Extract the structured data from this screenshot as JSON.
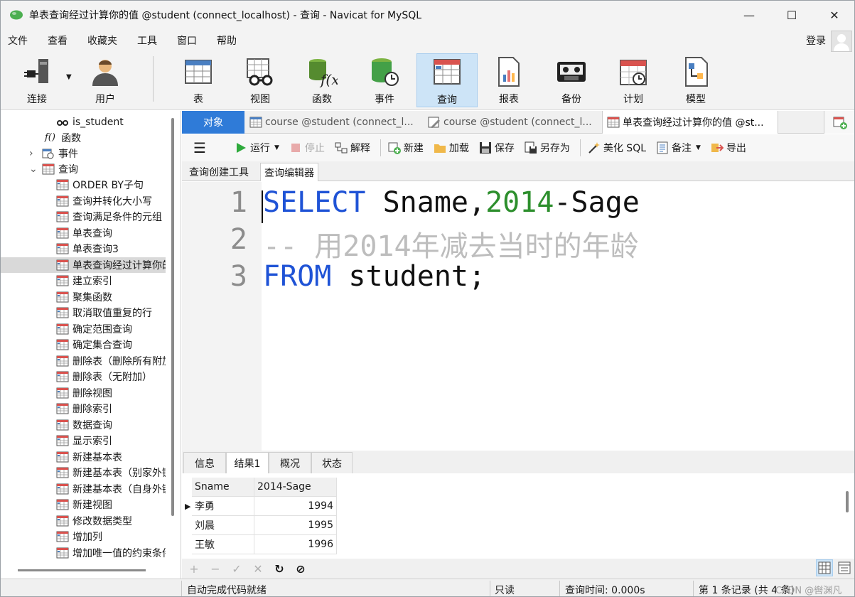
{
  "window": {
    "title": "单表查询经过计算你的值 @student (connect_localhost) - 查询 - Navicat for MySQL",
    "controls": {
      "minimize": "—",
      "maximize": "☐",
      "close": "✕"
    }
  },
  "menu": [
    "文件",
    "查看",
    "收藏夹",
    "工具",
    "窗口",
    "帮助"
  ],
  "login": "登录",
  "toolbar": [
    {
      "label": "连接",
      "icon": "connection-plug-icon"
    },
    {
      "label": "用户",
      "icon": "user-icon"
    },
    {
      "label": "表",
      "icon": "table-icon"
    },
    {
      "label": "视图",
      "icon": "view-glasses-icon"
    },
    {
      "label": "函数",
      "icon": "function-icon"
    },
    {
      "label": "事件",
      "icon": "event-database-clock-icon"
    },
    {
      "label": "查询",
      "icon": "query-icon",
      "active": true
    },
    {
      "label": "报表",
      "icon": "report-icon"
    },
    {
      "label": "备份",
      "icon": "backup-tape-icon"
    },
    {
      "label": "计划",
      "icon": "schedule-calendar-icon"
    },
    {
      "label": "模型",
      "icon": "model-diagram-icon"
    }
  ],
  "sidebar": {
    "items": [
      {
        "label": "is_student",
        "icon": "view-glasses-icon",
        "level": 3
      },
      {
        "label": "函数",
        "icon": "function-icon",
        "level": 2
      },
      {
        "label": "事件",
        "icon": "event-icon",
        "level": 1,
        "expander": "›"
      },
      {
        "label": "查询",
        "icon": "query-icon",
        "level": 1,
        "expander": "⌄"
      },
      {
        "label": "ORDER BY子句",
        "icon": "query-icon",
        "level": 3
      },
      {
        "label": "查询并转化大小写",
        "icon": "query-icon",
        "level": 3
      },
      {
        "label": "查询满足条件的元组",
        "icon": "query-icon",
        "level": 3
      },
      {
        "label": "单表查询",
        "icon": "query-icon",
        "level": 3
      },
      {
        "label": "单表查询3",
        "icon": "query-icon",
        "level": 3
      },
      {
        "label": "单表查询经过计算你的值",
        "icon": "query-icon",
        "level": 3,
        "selected": true
      },
      {
        "label": "建立索引",
        "icon": "query-icon",
        "level": 3
      },
      {
        "label": "聚集函数",
        "icon": "query-icon",
        "level": 3
      },
      {
        "label": "取消取值重复的行",
        "icon": "query-icon",
        "level": 3
      },
      {
        "label": "确定范围查询",
        "icon": "query-icon",
        "level": 3
      },
      {
        "label": "确定集合查询",
        "icon": "query-icon",
        "level": 3
      },
      {
        "label": "删除表（删除所有附加）",
        "icon": "query-icon",
        "level": 3
      },
      {
        "label": "删除表（无附加）",
        "icon": "query-icon",
        "level": 3
      },
      {
        "label": "删除视图",
        "icon": "query-icon",
        "level": 3
      },
      {
        "label": "删除索引",
        "icon": "query-icon",
        "level": 3
      },
      {
        "label": "数据查询",
        "icon": "query-icon",
        "level": 3
      },
      {
        "label": "显示索引",
        "icon": "query-icon",
        "level": 3
      },
      {
        "label": "新建基本表",
        "icon": "query-icon",
        "level": 3
      },
      {
        "label": "新建基本表（别家外键）",
        "icon": "query-icon",
        "level": 3
      },
      {
        "label": "新建基本表（自身外键）",
        "icon": "query-icon",
        "level": 3
      },
      {
        "label": "新建视图",
        "icon": "query-icon",
        "level": 3
      },
      {
        "label": "修改数据类型",
        "icon": "query-icon",
        "level": 3
      },
      {
        "label": "增加列",
        "icon": "query-icon",
        "level": 3
      },
      {
        "label": "增加唯一值的约束条件",
        "icon": "query-icon",
        "level": 3
      }
    ]
  },
  "tabs": [
    {
      "label": "对象"
    },
    {
      "label": "course @student (connect_l...",
      "icon": "table-icon"
    },
    {
      "label": "course @student (connect_l...",
      "icon": "design-table-icon"
    },
    {
      "label": "单表查询经过计算你的值 @st...",
      "icon": "query-icon",
      "active": true
    }
  ],
  "query_toolbar": {
    "menu_icon": "☰",
    "run": "运行",
    "stop": "停止",
    "explain": "解释",
    "new": "新建",
    "load": "加载",
    "save": "保存",
    "save_as": "另存为",
    "beautify": "美化 SQL",
    "comment": "备注",
    "export": "导出"
  },
  "subtabs": [
    "查询创建工具",
    "查询编辑器"
  ],
  "editor": {
    "lines": [
      {
        "num": "1",
        "kw": "SELECT",
        "rest1": " Sname,",
        "num_lit": "2014",
        "rest2": "-Sage"
      },
      {
        "num": "2",
        "comment": "-- 用2014年减去当时的年龄"
      },
      {
        "num": "3",
        "kw": "FROM",
        "rest1": " student;"
      }
    ]
  },
  "result_tabs": [
    "信息",
    "结果1",
    "概况",
    "状态"
  ],
  "result": {
    "columns": [
      "Sname",
      "2014-Sage"
    ],
    "rows": [
      [
        "李勇",
        "1994"
      ],
      [
        "刘晨",
        "1995"
      ],
      [
        "王敏",
        "1996"
      ]
    ]
  },
  "grid_buttons": [
    "+",
    "−",
    "✓",
    "✕",
    "↻",
    "⊘"
  ],
  "status": {
    "autocomplete": "自动完成代码就绪",
    "readonly": "只读",
    "query_time": "查询时间: 0.000s",
    "records": "第 1 条记录 (共 4 条)",
    "watermark": "CSDN @辔渊凡"
  },
  "colors": {
    "accent": "#2f7bd8",
    "keyword": "#1f53d6",
    "number": "#2d8f2d",
    "comment": "#bdbdbd"
  }
}
